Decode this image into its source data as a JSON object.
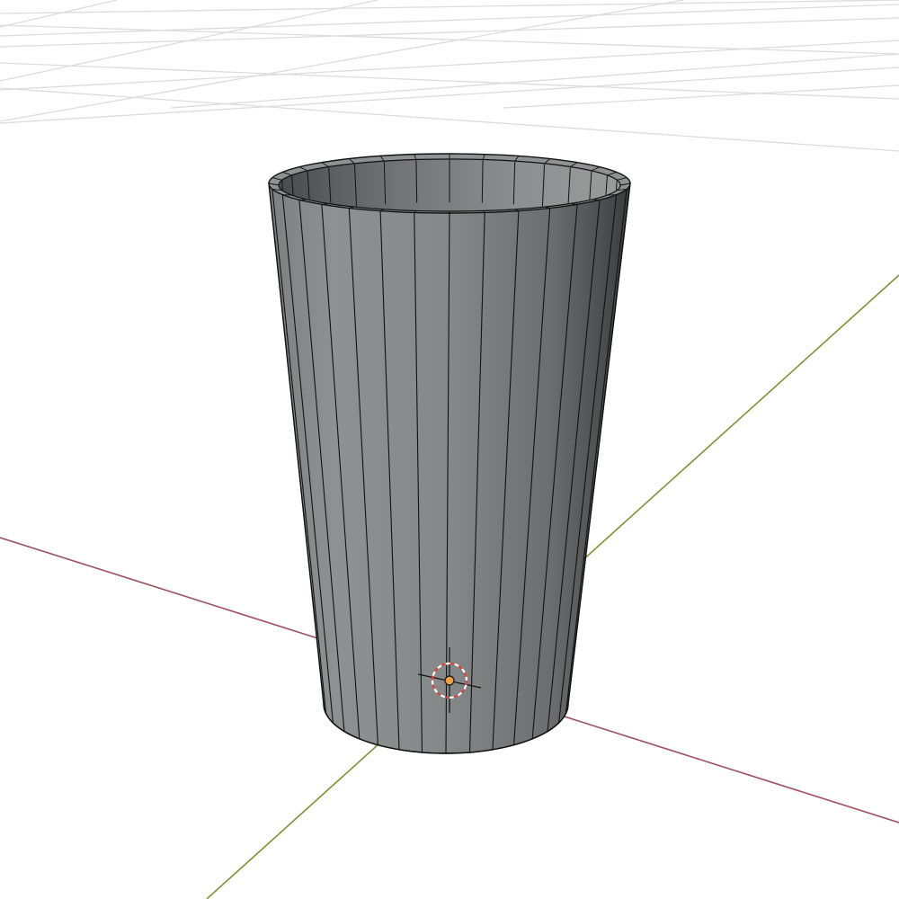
{
  "viewport": {
    "mode": "3d-viewport-solid-shading",
    "background_color": "#ffffff",
    "grid_line_color": "#dcdcdc",
    "x_axis_color": "#a0505e",
    "y_axis_color": "#7a9535"
  },
  "object": {
    "kind": "tapered-cylinder-cup",
    "segments": 32,
    "body_color": "#8a8d8d",
    "edge_color": "#111111",
    "interior_color": "#6c6e6f"
  },
  "cursor_3d": {
    "icon": "3d-cursor-icon",
    "ring_color_a": "#d9453a",
    "ring_color_b": "#ffffff"
  },
  "origin": {
    "icon": "object-origin-icon",
    "color": "#f0a040"
  }
}
